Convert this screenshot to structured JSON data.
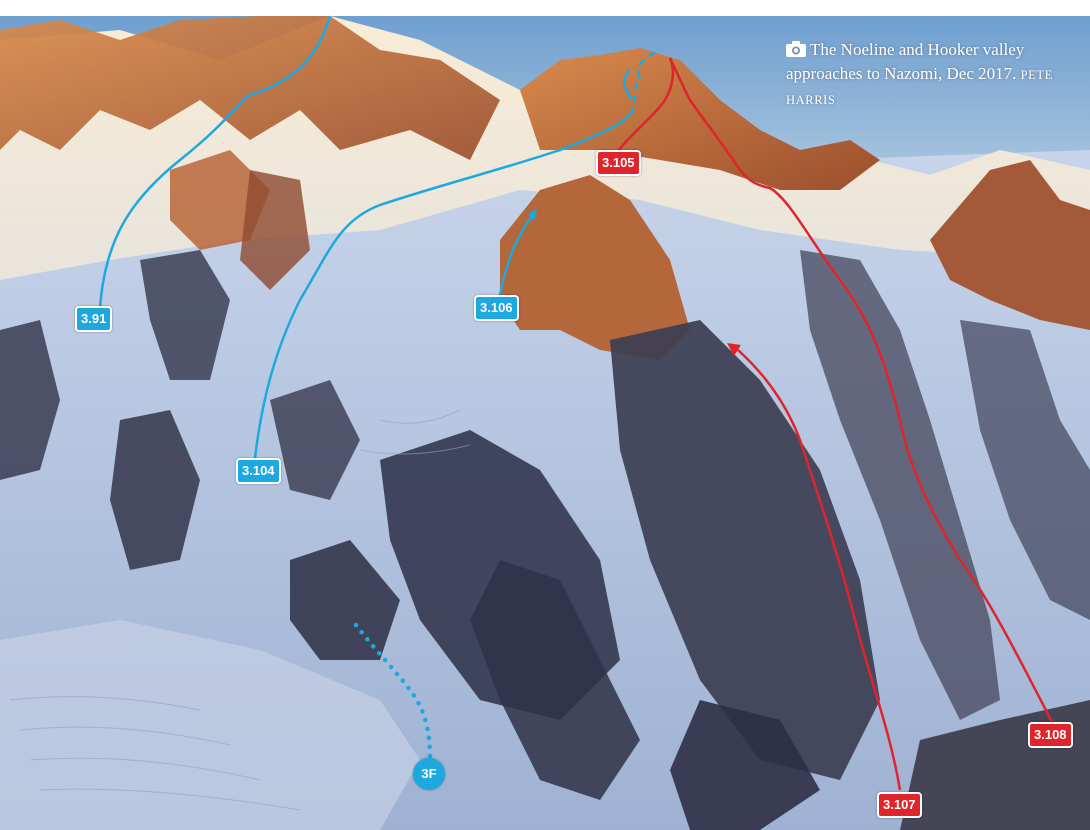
{
  "caption": {
    "text": "The Noeline and Hooker valley approaches to Nazomi, Dec 2017.",
    "credit": "PETE HARRIS",
    "icon": "camera-icon"
  },
  "routes": {
    "r391": {
      "label": "3.91",
      "color": "#1ea8e0",
      "style": "solid"
    },
    "r3104": {
      "label": "3.104",
      "color": "#1ea8e0",
      "style": "solid"
    },
    "r3105": {
      "label": "3.105",
      "color": "#e0242b",
      "style": "solid"
    },
    "r3106": {
      "label": "3.106",
      "color": "#1ea8e0",
      "style": "solid"
    },
    "r3107": {
      "label": "3.107",
      "color": "#e0242b",
      "style": "solid"
    },
    "r3108": {
      "label": "3.108",
      "color": "#e0242b",
      "style": "solid"
    },
    "r3F": {
      "label": "3F",
      "color": "#1ea8e0",
      "style": "dotted"
    }
  },
  "colors": {
    "blue_route": "#1ea8e0",
    "red_route": "#e0242b",
    "sky": "#7fa8cf",
    "alpenglow": "#c8713a",
    "snow": "#e9eef5",
    "shadow_snow": "#a9b9d6",
    "rock_shadow": "#3b3d52"
  }
}
